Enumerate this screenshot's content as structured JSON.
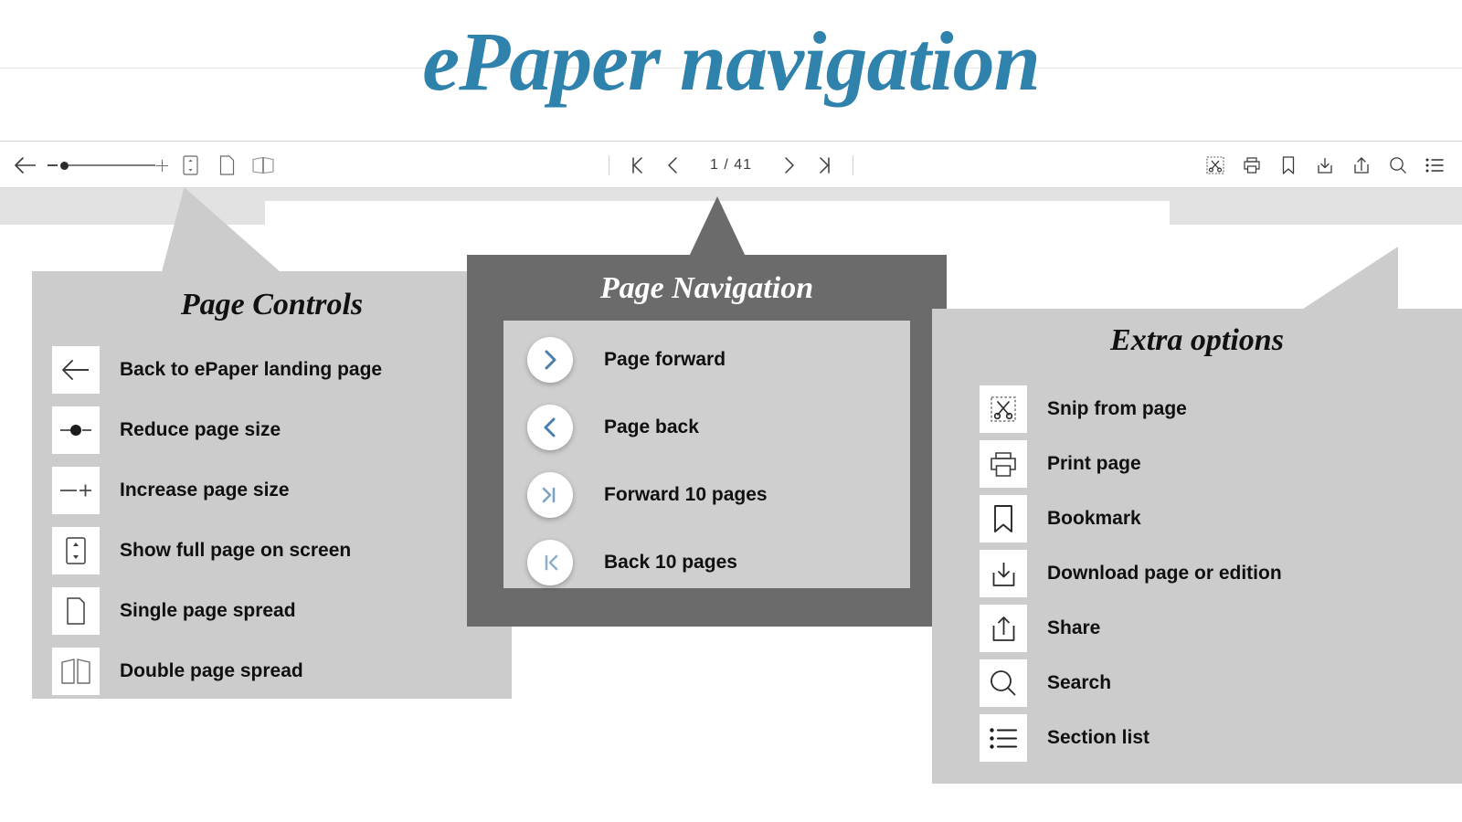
{
  "page": {
    "title": "ePaper navigation"
  },
  "toolbar": {
    "left_controls": [
      {
        "name": "back-arrow",
        "label": "Back to ePaper landing page"
      },
      {
        "name": "zoom-slider",
        "label": "Page size slider"
      },
      {
        "name": "fit-page",
        "label": "Show full page on screen"
      },
      {
        "name": "single-page",
        "label": "Single page spread"
      },
      {
        "name": "double-page",
        "label": "Double page spread"
      }
    ],
    "pager": {
      "first_label": "Back 10 pages",
      "prev_label": "Page back",
      "page_indicator": "1 / 41",
      "current_page": "1",
      "total_pages": "41",
      "next_label": "Page forward",
      "last_label": "Forward 10 pages"
    },
    "right_controls": [
      {
        "name": "snip-icon",
        "label": "Snip from page"
      },
      {
        "name": "print-icon",
        "label": "Print page"
      },
      {
        "name": "bookmark-icon",
        "label": "Bookmark"
      },
      {
        "name": "download-icon",
        "label": "Download page or edition"
      },
      {
        "name": "share-icon",
        "label": "Share"
      },
      {
        "name": "search-icon",
        "label": "Search"
      },
      {
        "name": "section-list-icon",
        "label": "Section list"
      }
    ]
  },
  "panels": {
    "page_controls": {
      "title": "Page Controls",
      "items": [
        {
          "icon": "back-arrow-icon",
          "label": "Back to ePaper landing page"
        },
        {
          "icon": "reduce-size-icon",
          "label": "Reduce page size"
        },
        {
          "icon": "increase-size-icon",
          "label": "Increase page size"
        },
        {
          "icon": "fit-page-icon",
          "label": "Show full page on screen"
        },
        {
          "icon": "single-page-icon",
          "label": "Single page spread"
        },
        {
          "icon": "double-page-icon",
          "label": "Double page spread"
        }
      ]
    },
    "page_navigation": {
      "title": "Page Navigation",
      "items": [
        {
          "icon": "chevron-right-icon",
          "label": "Page forward"
        },
        {
          "icon": "chevron-left-icon",
          "label": "Page back"
        },
        {
          "icon": "skip-forward-icon",
          "label": "Forward 10 pages"
        },
        {
          "icon": "skip-back-icon",
          "label": "Back 10 pages"
        }
      ]
    },
    "extra_options": {
      "title": "Extra options",
      "items": [
        {
          "icon": "snip-icon",
          "label": "Snip from page"
        },
        {
          "icon": "print-icon",
          "label": "Print page"
        },
        {
          "icon": "bookmark-icon",
          "label": "Bookmark"
        },
        {
          "icon": "download-icon",
          "label": "Download page or edition"
        },
        {
          "icon": "share-icon",
          "label": "Share"
        },
        {
          "icon": "search-icon",
          "label": "Search"
        },
        {
          "icon": "section-list-icon",
          "label": "Section list"
        }
      ]
    }
  },
  "colors": {
    "title_blue": "#2e82ab",
    "panel_grey": "#cccccc",
    "panel_dark_grey": "#6b6b6b",
    "band_grey": "#e2e2e2",
    "chevron_blue": "#4a7eab",
    "icon_stroke": "#3a3a3a"
  }
}
